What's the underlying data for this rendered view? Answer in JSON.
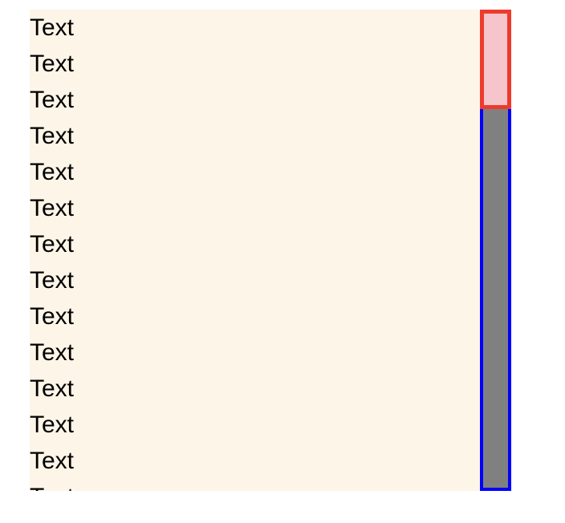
{
  "content": {
    "lines": [
      "Text",
      "Text",
      "Text",
      "Text",
      "Text",
      "Text",
      "Text",
      "Text",
      "Text",
      "Text",
      "Text",
      "Text",
      "Text",
      "Text"
    ]
  },
  "scrollbar": {
    "position_fraction": 0.0,
    "visible_fraction": 0.2,
    "colors": {
      "track": "#808080",
      "track_border": "#0000ff",
      "thumb": "#f6c5cc",
      "thumb_border": "#ee3a2c"
    }
  },
  "colors": {
    "content_background": "#fdf5e8",
    "text": "#000000"
  }
}
